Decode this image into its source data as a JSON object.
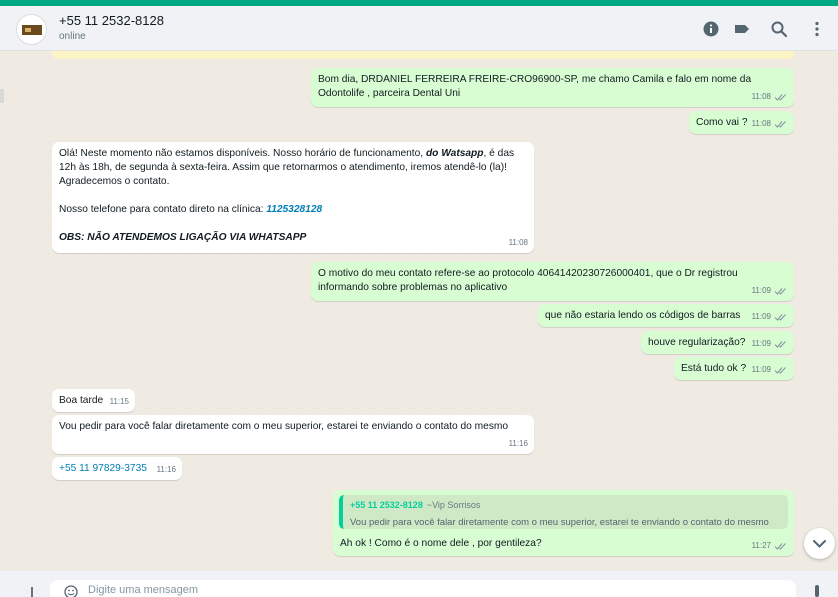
{
  "header": {
    "contact_name": "+55 11 2532-8128",
    "status": "online",
    "icons": [
      "info-icon",
      "label-icon",
      "search-icon",
      "menu-dots-icon"
    ]
  },
  "messages": [
    {
      "id": "m1",
      "direction": "out",
      "text": "Bom dia, DRDANIEL FERREIRA FREIRE-CRO96900-SP, me chamo Camila e falo em nome da Odontolife , parceira Dental Uni",
      "time": "11:08"
    },
    {
      "id": "m2",
      "direction": "out",
      "text": "Como vai ?",
      "time": "11:08"
    },
    {
      "id": "m3",
      "direction": "in",
      "time": "11:08",
      "line1_pre": "Olá! Neste momento não estamos disponíveis. Nosso horário de funcionamento, ",
      "line1_bold": "do Watsapp",
      "line1_post": ", é das 12h às 18h, de segunda à sexta-feira. Assim que retornarmos o atendimento, iremos atendê-lo (la)! Agradecemos o contato.",
      "phone_label": "Nosso telefone para contato direto na clínica: ",
      "phone_number": "1125328128",
      "obs": "OBS: NÃO ATENDEMOS LIGAÇÃO VIA WHATSAPP"
    },
    {
      "id": "m4",
      "direction": "out",
      "text": "O motivo do meu contato refere-se ao protocolo 40641420230726000401, que o Dr registrou informando sobre problemas no aplicativo",
      "time": "11:09"
    },
    {
      "id": "m5",
      "direction": "out",
      "text": "que não estaria lendo os códigos de barras",
      "time": "11:09"
    },
    {
      "id": "m6",
      "direction": "out",
      "text": "houve regularização?",
      "time": "11:09"
    },
    {
      "id": "m7",
      "direction": "out",
      "text": "Está tudo ok ?",
      "time": "11:09"
    },
    {
      "id": "m8",
      "direction": "in",
      "text": "Boa tarde",
      "time": "11:15"
    },
    {
      "id": "m9",
      "direction": "in",
      "text": "Vou pedir para você falar diretamente com o meu superior, estarei te enviando o contato do mesmo",
      "time": "11:16"
    },
    {
      "id": "m10",
      "direction": "in",
      "text": "+55 11 97829-3735",
      "time": "11:16"
    },
    {
      "id": "m11",
      "direction": "out",
      "time": "11:27",
      "quote_author": "+55 11 2532-8128",
      "quote_alias": "~Vip Sorrisos",
      "quote_text": "Vou pedir para você falar diretamente com o meu superior, estarei te enviando o contato do mesmo",
      "text": "Ah ok ! Como é o nome dele , por gentileza?"
    }
  ],
  "composer": {
    "placeholder": "Digite uma mensagem"
  },
  "colors": {
    "accent": "#00a884",
    "outgoing_bubble": "#d9fdd3",
    "incoming_bubble": "#ffffff",
    "read_ticks": "#53bdeb",
    "link": "#027eb5"
  }
}
